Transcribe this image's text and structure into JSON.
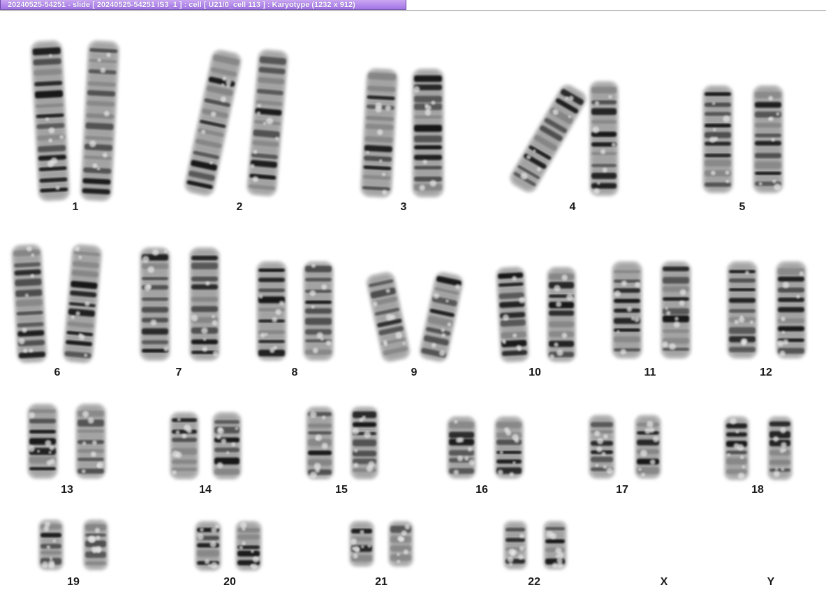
{
  "window": {
    "title": "20240525-54251 - slide [ 20240525-54251 IS3_1 ] : cell [ U21/0_cell 113 ] : Karyotype  (1232 x 912)"
  },
  "karyotype": {
    "chromosome_labels": [
      "1",
      "2",
      "3",
      "4",
      "5",
      "6",
      "7",
      "8",
      "9",
      "10",
      "11",
      "12",
      "13",
      "14",
      "15",
      "16",
      "17",
      "18",
      "19",
      "20",
      "21",
      "22",
      "X",
      "Y"
    ]
  }
}
